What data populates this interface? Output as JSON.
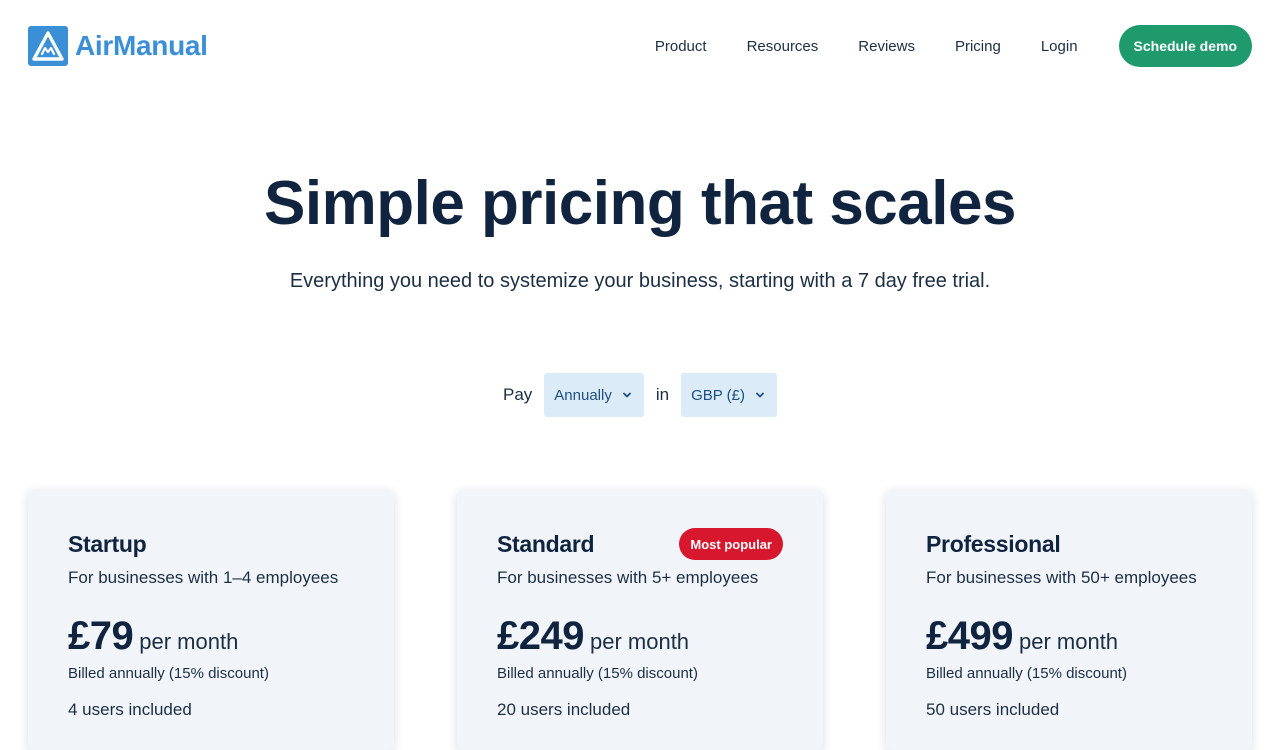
{
  "brand": {
    "name": "AirManual",
    "color": "#3b8fd6"
  },
  "nav": {
    "items": [
      {
        "label": "Product"
      },
      {
        "label": "Resources"
      },
      {
        "label": "Reviews"
      },
      {
        "label": "Pricing"
      },
      {
        "label": "Login"
      }
    ],
    "cta_label": "Schedule demo",
    "cta_color": "#1f9a6c"
  },
  "hero": {
    "title": "Simple pricing that scales",
    "subtitle": "Everything you need to systemize your business, starting with a 7 day free trial."
  },
  "billing": {
    "pay_label": "Pay",
    "period_value": "Annually",
    "in_label": "in",
    "currency_value": "GBP (£)"
  },
  "plans": [
    {
      "name": "Startup",
      "description": "For businesses with 1–4 employees",
      "price": "£79",
      "period": "per month",
      "billing_note": "Billed annually (15% discount)",
      "users": "4 users included"
    },
    {
      "name": "Standard",
      "badge": "Most popular",
      "description": "For businesses with 5+ employees",
      "price": "£249",
      "period": "per month",
      "billing_note": "Billed annually (15% discount)",
      "users": "20 users included"
    },
    {
      "name": "Professional",
      "description": "For businesses with 50+ employees",
      "price": "£499",
      "period": "per month",
      "billing_note": "Billed annually (15% discount)",
      "users": "50 users included"
    }
  ],
  "colors": {
    "heading": "#10243f",
    "badge": "#d7172e",
    "select_bg": "#dcebf8",
    "card_bg": "#f1f5f9"
  }
}
